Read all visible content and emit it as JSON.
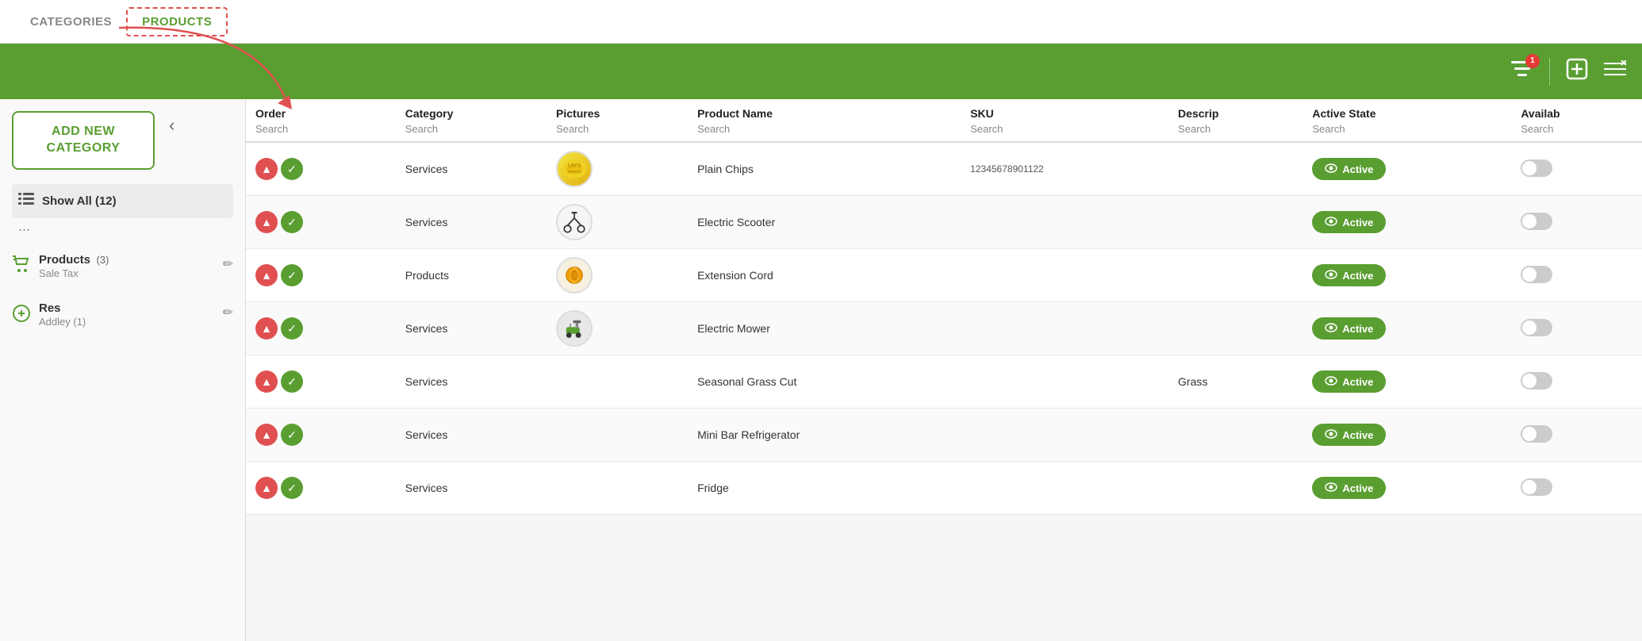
{
  "nav": {
    "tabs": [
      {
        "id": "categories",
        "label": "CATEGORIES",
        "active": false
      },
      {
        "id": "products",
        "label": "PRODUCTS",
        "active": true
      }
    ]
  },
  "toolbar": {
    "notification_count": "1",
    "filter_icon": "≡",
    "add_icon": "+",
    "layers_icon": "⊗"
  },
  "sidebar": {
    "add_button_label": "ADD NEW CATEGORY",
    "show_all_label": "Show All (12)",
    "ellipsis": "...",
    "back_icon": "‹",
    "categories": [
      {
        "name": "Products",
        "count": "(3)",
        "tax": "Sale Tax",
        "icon": "cart"
      },
      {
        "name": "Res",
        "count": "",
        "tax": "Addley (1)",
        "icon": "plus-circle"
      }
    ]
  },
  "table": {
    "headers": [
      "Order",
      "Category",
      "Pictures",
      "Product Name",
      "SKU",
      "Descrip",
      "Active State",
      "Availab"
    ],
    "search_labels": [
      "Search",
      "Search",
      "Search",
      "Search",
      "Search",
      "Search",
      "Search",
      "Search"
    ],
    "rows": [
      {
        "category": "Services",
        "has_image": true,
        "image_type": "chips",
        "product_name": "Plain Chips",
        "sku": "12345678901122",
        "description": "",
        "active_state": "Active",
        "available": ""
      },
      {
        "category": "Services",
        "has_image": true,
        "image_type": "scooter",
        "product_name": "Electric Scooter",
        "sku": "",
        "description": "",
        "active_state": "Active",
        "available": ""
      },
      {
        "category": "Products",
        "has_image": true,
        "image_type": "cord",
        "product_name": "Extension Cord",
        "sku": "",
        "description": "",
        "active_state": "Active",
        "available": ""
      },
      {
        "category": "Services",
        "has_image": true,
        "image_type": "mower",
        "product_name": "Electric Mower",
        "sku": "",
        "description": "",
        "active_state": "Active",
        "available": ""
      },
      {
        "category": "Services",
        "has_image": false,
        "image_type": "",
        "product_name": "Seasonal Grass Cut",
        "sku": "",
        "description": "Grass",
        "active_state": "Active",
        "available": ""
      },
      {
        "category": "Services",
        "has_image": false,
        "image_type": "",
        "product_name": "Mini Bar Refrigerator",
        "sku": "",
        "description": "",
        "active_state": "Active",
        "available": ""
      },
      {
        "category": "Services",
        "has_image": false,
        "image_type": "",
        "product_name": "Fridge",
        "sku": "",
        "description": "",
        "active_state": "Active",
        "available": ""
      }
    ]
  },
  "colors": {
    "green": "#5a9e32",
    "red": "#e05050",
    "toolbar_green": "#4e9030"
  }
}
